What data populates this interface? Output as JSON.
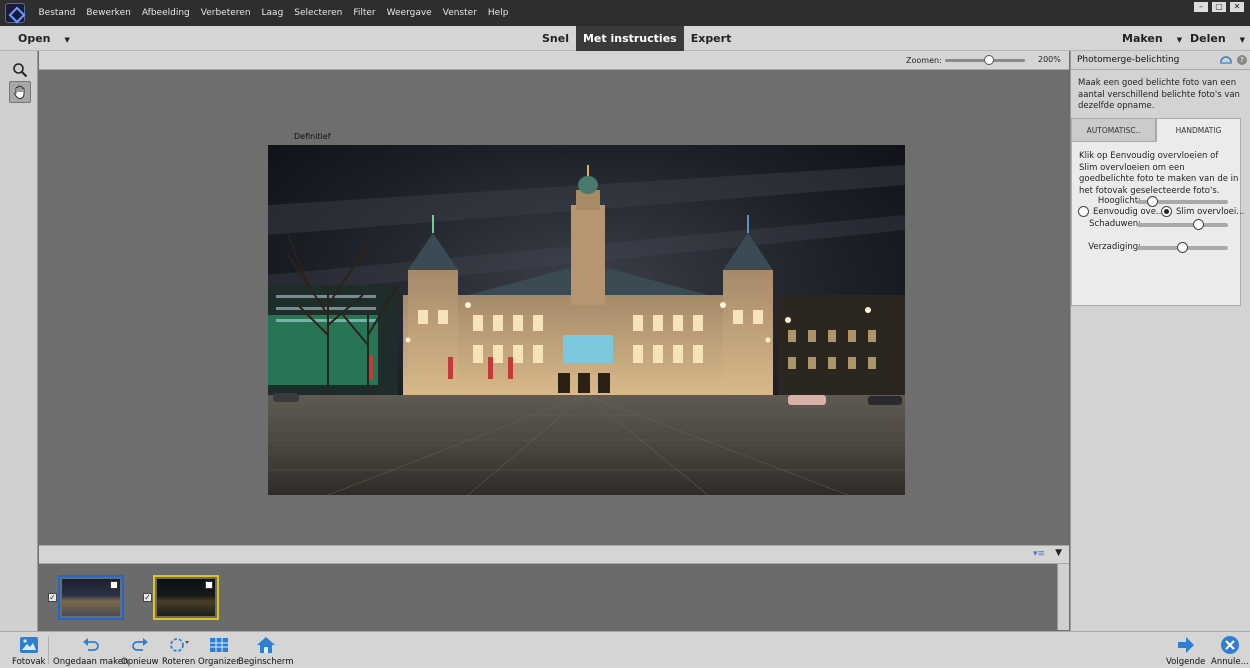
{
  "menu": {
    "items": [
      "Bestand",
      "Bewerken",
      "Afbeelding",
      "Verbeteren",
      "Laag",
      "Selecteren",
      "Filter",
      "Weergave",
      "Venster",
      "Help"
    ]
  },
  "window_controls": {
    "minimize": "–",
    "restore": "▢",
    "close": "✕"
  },
  "modebar": {
    "open_label": "Open",
    "tabs": [
      "Snel",
      "Met instructies",
      "Expert"
    ],
    "active_tab": "Met instructies",
    "maken_label": "Maken",
    "delen_label": "Delen"
  },
  "toolbox": {
    "tools": [
      {
        "name": "zoom-tool",
        "icon": "magnifier-icon",
        "active": false
      },
      {
        "name": "hand-tool",
        "icon": "hand-icon",
        "active": true
      }
    ]
  },
  "options": {
    "zoom_label": "Zoomen:",
    "zoom_value": "200%",
    "zoom_slider_fraction": 0.55
  },
  "canvas": {
    "final_label": "Definitief"
  },
  "photobin": {
    "thumbnails": [
      {
        "checked": true,
        "selected": true,
        "border_color": "#1e66d0"
      },
      {
        "checked": true,
        "selected": false,
        "border_color": "#e0c41a"
      }
    ]
  },
  "panel": {
    "title": "Photomerge-belichting",
    "description": "Maak een goed belichte foto van een aantal verschillend belichte foto's van dezelfde opname.",
    "tabs": [
      "AUTOMATISC..",
      "HANDMATIG"
    ],
    "active_tab": "HANDMATIG",
    "settings_description": "Klik op Eenvoudig overvloeien of Slim overvloeien om een goedbelichte foto te maken van de in het fotovak geselecteerde foto's.",
    "radio_simple": "Eenvoudig ove...",
    "radio_smart": "Slim overvloei...",
    "radio_selected": "smart",
    "sliders": [
      {
        "label": "Hooglicht:",
        "value": 0.17
      },
      {
        "label": "Schaduwen:",
        "value": 0.67
      },
      {
        "label": "Verzadiging:",
        "value": 0.49
      }
    ]
  },
  "taskbar": {
    "left": [
      {
        "label": "Fotovak",
        "icon": "photo-bin-icon"
      },
      {
        "label": "Ongedaan maken",
        "icon": "undo-icon"
      },
      {
        "label": "Opnieuw",
        "icon": "redo-icon"
      },
      {
        "label": "Roteren",
        "icon": "rotate-icon"
      },
      {
        "label": "Organizer",
        "icon": "organizer-icon"
      },
      {
        "label": "Beginscherm",
        "icon": "home-icon"
      }
    ],
    "right": [
      {
        "label": "Volgende",
        "icon": "next-arrow-icon"
      },
      {
        "label": "Annule...",
        "icon": "cancel-icon"
      }
    ]
  },
  "colors": {
    "accent_blue": "#1e66d0",
    "accent_yellow": "#e0c41a",
    "icon_blue": "#2f7fd1"
  }
}
